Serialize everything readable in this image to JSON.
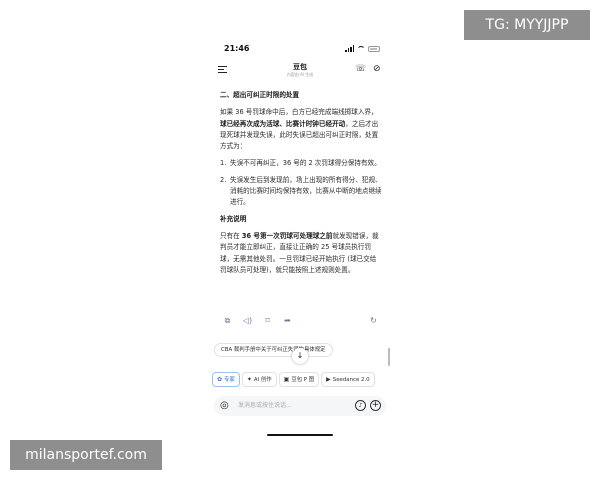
{
  "watermarks": {
    "top_right": "TG: MYYJJPP",
    "bottom_left": "milansportef.com"
  },
  "status_bar": {
    "time": "21:46",
    "icons": [
      "signal-icon",
      "wifi-icon",
      "battery-icon"
    ]
  },
  "chat_header": {
    "title": "豆包",
    "subtitle": "内容由 AI 生成",
    "icons": [
      "menu-icon",
      "phone-icon",
      "mute-icon"
    ]
  },
  "message": {
    "section_title": "二、超出可纠正时限的处置",
    "para1_pre": "如果 36 号罚球命中后，白方已经完成端线掷球入界，",
    "para1_bold": "球已经再次成为活球、比赛计时钟已经开动",
    "para1_post": "，之后才出现死球并发现失误，此时失误已超出可纠正时限，处置方式为：",
    "list": [
      {
        "num": "1.",
        "text": "失误不可再纠正，36 号的 2 次罚球得分保持有效。"
      },
      {
        "num": "2.",
        "text": "失误发生后到发现前，场上出现的所有得分、犯规、消耗的比赛时间均保持有效，比赛从中断的地点继续进行。"
      }
    ],
    "supplement_title": "补充说明",
    "para2_pre": "只有在 ",
    "para2_bold": "36 号第一次罚球可处理球之前",
    "para2_post": "就发现错误，裁判员才能立即纠正，直接让正确的 25 号球员执行罚球，无需其他处罚。一旦罚球已经开始执行 (球已交给罚球队员可处理)，就只能按照上述规则处置。"
  },
  "message_actions": [
    "copy-icon",
    "speaker-icon",
    "bookmark-icon",
    "share-icon",
    "regenerate-icon"
  ],
  "suggestion": "CBA 裁判手册中关于可纠正失误的具体规定",
  "chips": [
    {
      "icon": "✿",
      "label": "专家",
      "active": true
    },
    {
      "icon": "✦",
      "label": "AI 创作",
      "active": false
    },
    {
      "icon": "▣",
      "label": "豆包 P 图",
      "active": false
    },
    {
      "icon": "▶",
      "label": "Seedance 2.0",
      "active": false
    }
  ],
  "input": {
    "placeholder": "发消息或按住说话..."
  },
  "colors": {
    "accent": "#2f6fd6",
    "watermark_bg": "#8e8e8e",
    "input_bg": "#f5f6f8"
  }
}
